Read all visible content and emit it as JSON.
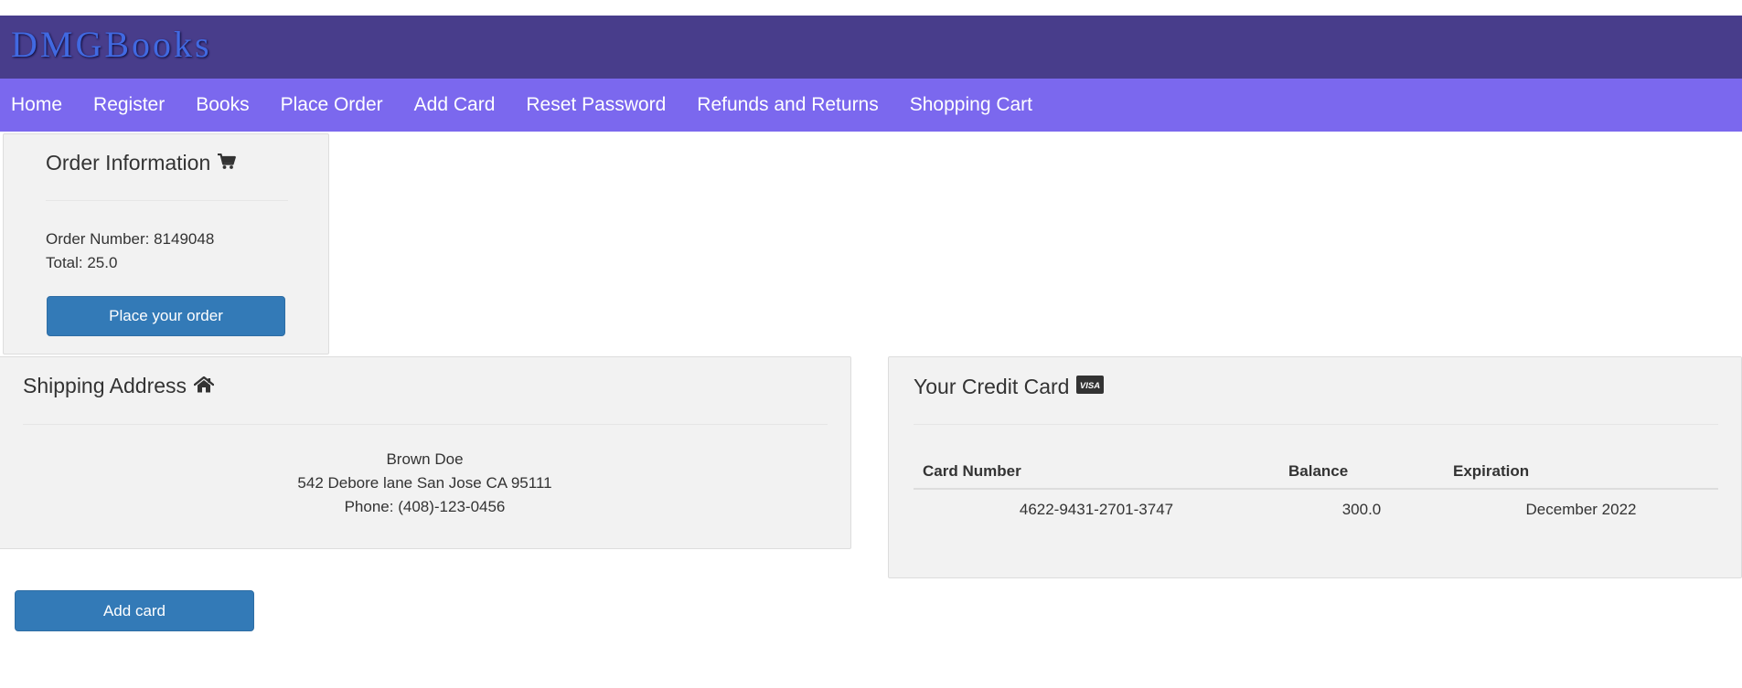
{
  "header": {
    "brand": "DMGBooks",
    "brand_color": "#4169e1",
    "header_bg": "#483d8b",
    "nav_bg": "#7b68ee"
  },
  "nav": {
    "items": [
      {
        "label": "Home"
      },
      {
        "label": "Register"
      },
      {
        "label": "Books"
      },
      {
        "label": "Place Order"
      },
      {
        "label": "Add Card"
      },
      {
        "label": "Reset Password"
      },
      {
        "label": "Refunds and Returns"
      },
      {
        "label": "Shopping Cart"
      }
    ]
  },
  "order": {
    "title": "Order Information",
    "icon": "shopping-cart-icon",
    "order_number_line": "Order Number: 8149048",
    "total_line": "Total: 25.0",
    "place_order_label": "Place your order"
  },
  "shipping": {
    "title": "Shipping Address",
    "icon": "home-icon",
    "name": "Brown Doe",
    "address": "542 Debore lane San Jose CA 95111",
    "phone": "Phone: (408)-123-0456"
  },
  "credit_card": {
    "title": "Your Credit Card",
    "icon": "visa-card-icon",
    "icon_text": "VISA",
    "columns": [
      "Card Number",
      "Balance",
      "Expiration"
    ],
    "rows": [
      {
        "card_number": "4622-9431-2701-3747",
        "balance": "300.0",
        "expiration": "December 2022"
      }
    ]
  },
  "actions": {
    "add_card_label": "Add card",
    "button_color": "#337ab7"
  }
}
